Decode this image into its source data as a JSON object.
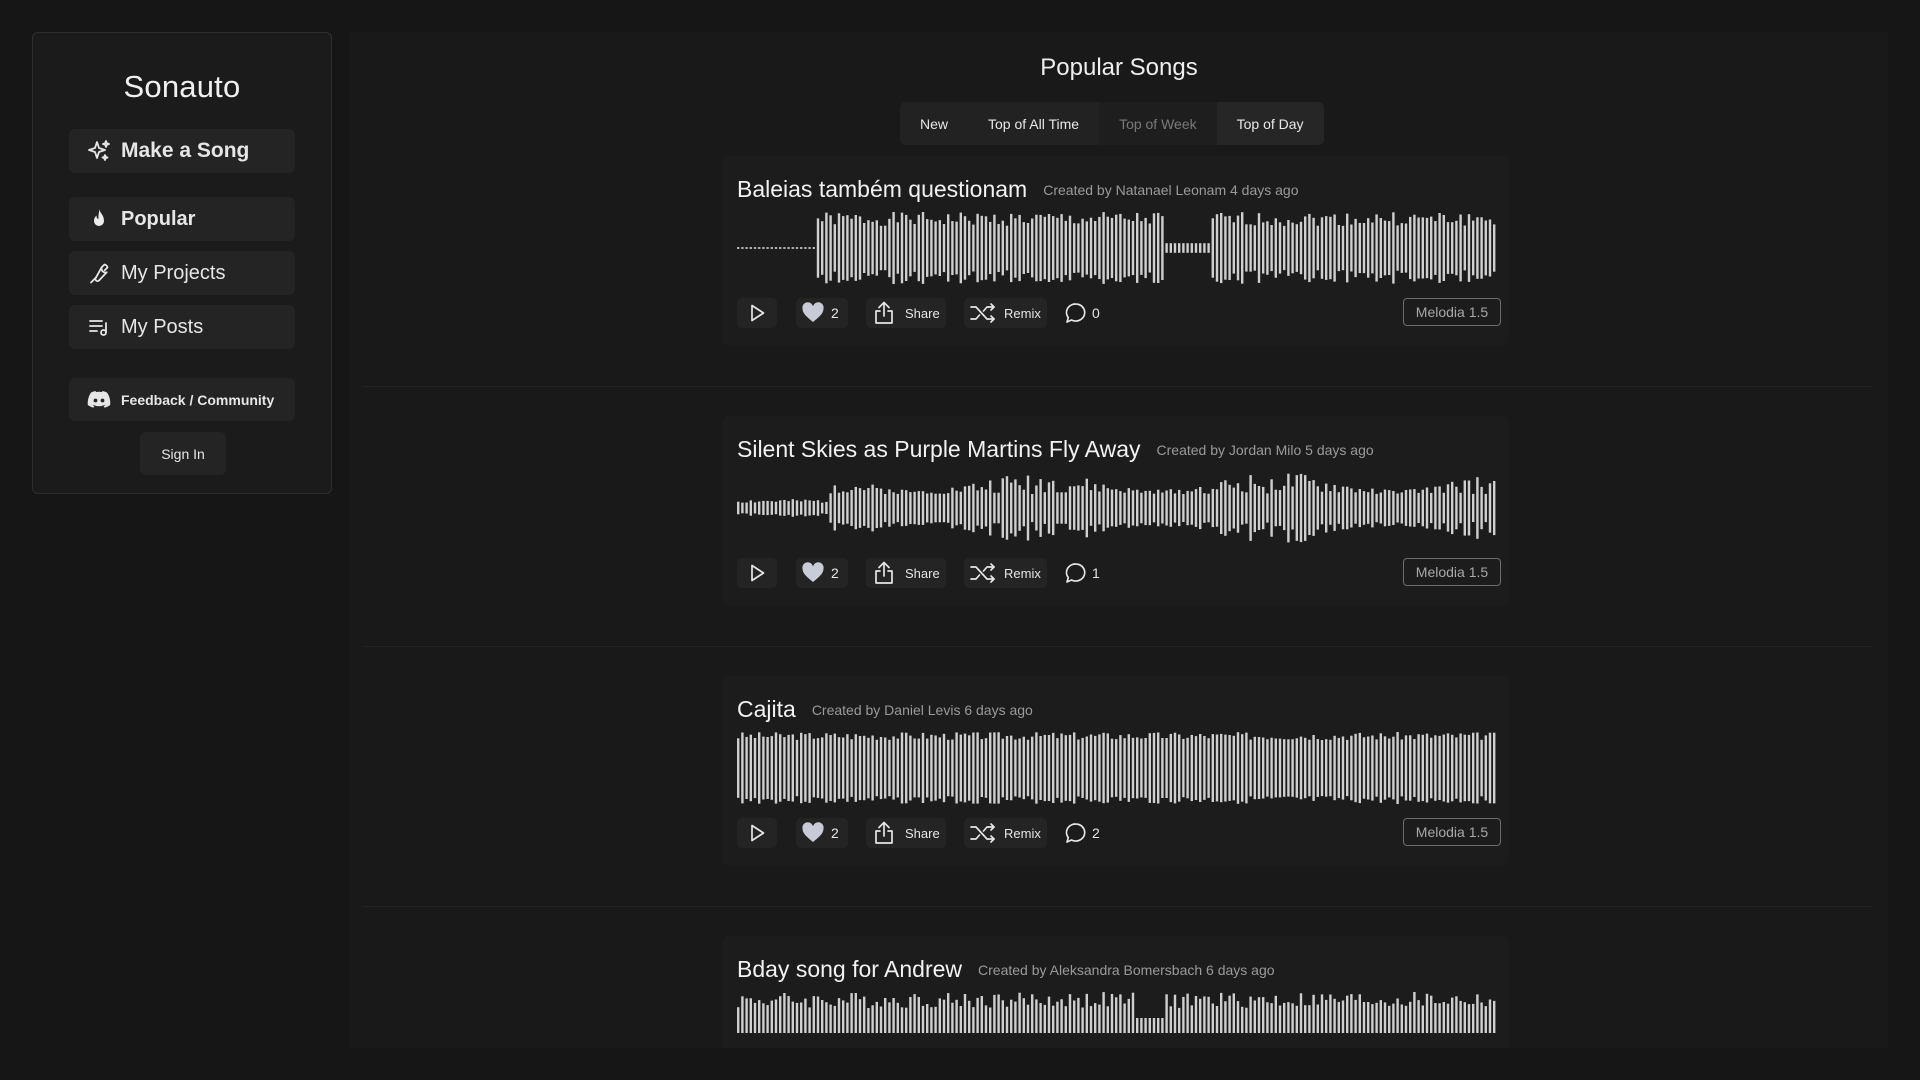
{
  "sidebar": {
    "brand": "Sonauto",
    "make_label": "Make a Song",
    "popular_label": "Popular",
    "projects_label": "My Projects",
    "posts_label": "My Posts",
    "feedback_label": "Feedback / Community",
    "signin_label": "Sign In",
    "icons": [
      "sparkles-icon",
      "flame-icon",
      "wrench-icon",
      "playlist-icon",
      "discord-icon"
    ]
  },
  "main": {
    "title": "Popular Songs",
    "tabs": [
      {
        "label": "New",
        "state": "active"
      },
      {
        "label": "Top of All Time",
        "state": "normal"
      },
      {
        "label": "Top of Week",
        "state": "dim"
      },
      {
        "label": "Top of Day",
        "state": "normal"
      }
    ]
  },
  "songs": [
    {
      "title": "Baleias também questionam",
      "credit": "Created by Natanael Leonam 4 days ago",
      "likes": "2",
      "comments": "0",
      "model": "Melodia 1.5"
    },
    {
      "title": "Silent Skies as Purple Martins Fly Away",
      "credit": "Created by Jordan Milo 5 days ago",
      "likes": "2",
      "comments": "1",
      "model": "Melodia 1.5"
    },
    {
      "title": "Cajita",
      "credit": "Created by Daniel Levis 6 days ago",
      "likes": "2",
      "comments": "2",
      "model": "Melodia 1.5"
    },
    {
      "title": "Bday song for Andrew",
      "credit": "Created by Aleksandra Bomersbach 6 days ago",
      "likes": "",
      "comments": "",
      "model": ""
    }
  ],
  "labels": {
    "share": "Share",
    "remix": "Remix"
  },
  "colors": {
    "background": "#161616",
    "panel": "#1b1b1b",
    "card": "#1c1c1c",
    "button": "#242424",
    "waveform": "#cfcfcf",
    "accent_text": "#e8e8e8"
  }
}
